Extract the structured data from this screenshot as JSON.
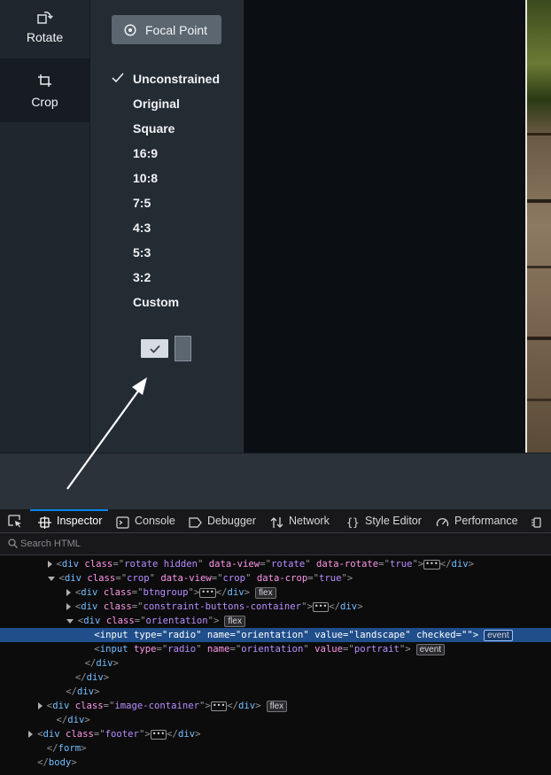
{
  "tools": {
    "rotate_label": "Rotate",
    "crop_label": "Crop"
  },
  "panel": {
    "focal_point_label": "Focal Point",
    "constraints": [
      "Unconstrained",
      "Original",
      "Square",
      "16:9",
      "10:8",
      "7:5",
      "4:3",
      "5:3",
      "3:2",
      "Custom"
    ],
    "selected_constraint": "Unconstrained",
    "orientation_selected": "landscape"
  },
  "devtools": {
    "tabs": [
      "Inspector",
      "Console",
      "Debugger",
      "Network",
      "Style Editor",
      "Performance"
    ],
    "active_tab": "Inspector",
    "search_placeholder": "Search HTML",
    "tree": [
      {
        "indent": 5,
        "tw": "r",
        "parts": [
          [
            "p",
            "<"
          ],
          [
            "tag",
            "div"
          ],
          [
            "sp",
            " "
          ],
          [
            "an",
            "class"
          ],
          [
            "p",
            "=\""
          ],
          [
            "av",
            "rotate hidden"
          ],
          [
            "p",
            "\""
          ],
          [
            "sp",
            " "
          ],
          [
            "an",
            "data-view"
          ],
          [
            "p",
            "=\""
          ],
          [
            "av",
            "rotate"
          ],
          [
            "p",
            "\""
          ],
          [
            "sp",
            " "
          ],
          [
            "an",
            "data-rotate"
          ],
          [
            "p",
            "=\""
          ],
          [
            "av",
            "true"
          ],
          [
            "p",
            "\">"
          ],
          [
            "ell",
            ""
          ],
          [
            "p",
            "</"
          ],
          [
            "tag",
            "div"
          ],
          [
            "p",
            ">"
          ]
        ]
      },
      {
        "indent": 5,
        "tw": "d",
        "parts": [
          [
            "p",
            "<"
          ],
          [
            "tag",
            "div"
          ],
          [
            "sp",
            " "
          ],
          [
            "an",
            "class"
          ],
          [
            "p",
            "=\""
          ],
          [
            "av",
            "crop"
          ],
          [
            "p",
            "\""
          ],
          [
            "sp",
            " "
          ],
          [
            "an",
            "data-view"
          ],
          [
            "p",
            "=\""
          ],
          [
            "av",
            "crop"
          ],
          [
            "p",
            "\""
          ],
          [
            "sp",
            " "
          ],
          [
            "an",
            "data-crop"
          ],
          [
            "p",
            "=\""
          ],
          [
            "av",
            "true"
          ],
          [
            "p",
            "\">"
          ]
        ]
      },
      {
        "indent": 7,
        "tw": "r",
        "parts": [
          [
            "p",
            "<"
          ],
          [
            "tag",
            "div"
          ],
          [
            "sp",
            " "
          ],
          [
            "an",
            "class"
          ],
          [
            "p",
            "=\""
          ],
          [
            "av",
            "btngroup"
          ],
          [
            "p",
            "\">"
          ],
          [
            "ell",
            ""
          ],
          [
            "p",
            "</"
          ],
          [
            "tag",
            "div"
          ],
          [
            "p",
            ">"
          ],
          [
            "badge",
            "flex"
          ]
        ]
      },
      {
        "indent": 7,
        "tw": "r",
        "parts": [
          [
            "p",
            "<"
          ],
          [
            "tag",
            "div"
          ],
          [
            "sp",
            " "
          ],
          [
            "an",
            "class"
          ],
          [
            "p",
            "=\""
          ],
          [
            "av",
            "constraint-buttons-container"
          ],
          [
            "p",
            "\">"
          ],
          [
            "ell",
            ""
          ],
          [
            "p",
            "</"
          ],
          [
            "tag",
            "div"
          ],
          [
            "p",
            ">"
          ]
        ]
      },
      {
        "indent": 7,
        "tw": "d",
        "parts": [
          [
            "p",
            "<"
          ],
          [
            "tag",
            "div"
          ],
          [
            "sp",
            " "
          ],
          [
            "an",
            "class"
          ],
          [
            "p",
            "=\""
          ],
          [
            "av",
            "orientation"
          ],
          [
            "p",
            "\">"
          ],
          [
            "badge",
            "flex"
          ]
        ]
      },
      {
        "indent": 9,
        "tw": "",
        "sel": true,
        "parts": [
          [
            "p",
            "<"
          ],
          [
            "tag",
            "input"
          ],
          [
            "sp",
            " "
          ],
          [
            "an",
            "type"
          ],
          [
            "p",
            "=\""
          ],
          [
            "av",
            "radio"
          ],
          [
            "p",
            "\""
          ],
          [
            "sp",
            " "
          ],
          [
            "an",
            "name"
          ],
          [
            "p",
            "=\""
          ],
          [
            "av",
            "orientation"
          ],
          [
            "p",
            "\""
          ],
          [
            "sp",
            " "
          ],
          [
            "an",
            "value"
          ],
          [
            "p",
            "=\""
          ],
          [
            "av",
            "landscape"
          ],
          [
            "p",
            "\""
          ],
          [
            "sp",
            " "
          ],
          [
            "an",
            "checked"
          ],
          [
            "p",
            "=\"\">"
          ],
          [
            "badge",
            "event"
          ]
        ]
      },
      {
        "indent": 9,
        "tw": "",
        "parts": [
          [
            "p",
            "<"
          ],
          [
            "tag",
            "input"
          ],
          [
            "sp",
            " "
          ],
          [
            "an",
            "type"
          ],
          [
            "p",
            "=\""
          ],
          [
            "av",
            "radio"
          ],
          [
            "p",
            "\""
          ],
          [
            "sp",
            " "
          ],
          [
            "an",
            "name"
          ],
          [
            "p",
            "=\""
          ],
          [
            "av",
            "orientation"
          ],
          [
            "p",
            "\""
          ],
          [
            "sp",
            " "
          ],
          [
            "an",
            "value"
          ],
          [
            "p",
            "=\""
          ],
          [
            "av",
            "portrait"
          ],
          [
            "p",
            "\">"
          ],
          [
            "badge",
            "event"
          ]
        ]
      },
      {
        "indent": 8,
        "tw": "",
        "parts": [
          [
            "p",
            "</"
          ],
          [
            "tag",
            "div"
          ],
          [
            "p",
            ">"
          ]
        ]
      },
      {
        "indent": 7,
        "tw": "",
        "parts": [
          [
            "p",
            "</"
          ],
          [
            "tag",
            "div"
          ],
          [
            "p",
            ">"
          ]
        ]
      },
      {
        "indent": 6,
        "tw": "",
        "parts": [
          [
            "p",
            "</"
          ],
          [
            "tag",
            "div"
          ],
          [
            "p",
            ">"
          ]
        ]
      },
      {
        "indent": 4,
        "tw": "r",
        "parts": [
          [
            "p",
            "<"
          ],
          [
            "tag",
            "div"
          ],
          [
            "sp",
            " "
          ],
          [
            "an",
            "class"
          ],
          [
            "p",
            "=\""
          ],
          [
            "av",
            "image-container"
          ],
          [
            "p",
            "\">"
          ],
          [
            "ell",
            ""
          ],
          [
            "p",
            "</"
          ],
          [
            "tag",
            "div"
          ],
          [
            "p",
            ">"
          ],
          [
            "badge",
            "flex"
          ]
        ]
      },
      {
        "indent": 5,
        "tw": "",
        "parts": [
          [
            "p",
            "</"
          ],
          [
            "tag",
            "div"
          ],
          [
            "p",
            ">"
          ]
        ]
      },
      {
        "indent": 3,
        "tw": "r",
        "parts": [
          [
            "p",
            "<"
          ],
          [
            "tag",
            "div"
          ],
          [
            "sp",
            " "
          ],
          [
            "an",
            "class"
          ],
          [
            "p",
            "=\""
          ],
          [
            "av",
            "footer"
          ],
          [
            "p",
            "\">"
          ],
          [
            "ell",
            ""
          ],
          [
            "p",
            "</"
          ],
          [
            "tag",
            "div"
          ],
          [
            "p",
            ">"
          ]
        ]
      },
      {
        "indent": 4,
        "tw": "",
        "parts": [
          [
            "p",
            "</"
          ],
          [
            "tag",
            "form"
          ],
          [
            "p",
            ">"
          ]
        ]
      },
      {
        "indent": 3,
        "tw": "",
        "parts": [
          [
            "p",
            "</"
          ],
          [
            "tag",
            "body"
          ],
          [
            "p",
            ">"
          ]
        ]
      }
    ]
  },
  "colors": {
    "accent": "#0a84ff",
    "selection": "#204e8a",
    "tag": "#75bfff",
    "attr_name": "#ff97e8",
    "attr_value": "#b98eff"
  }
}
